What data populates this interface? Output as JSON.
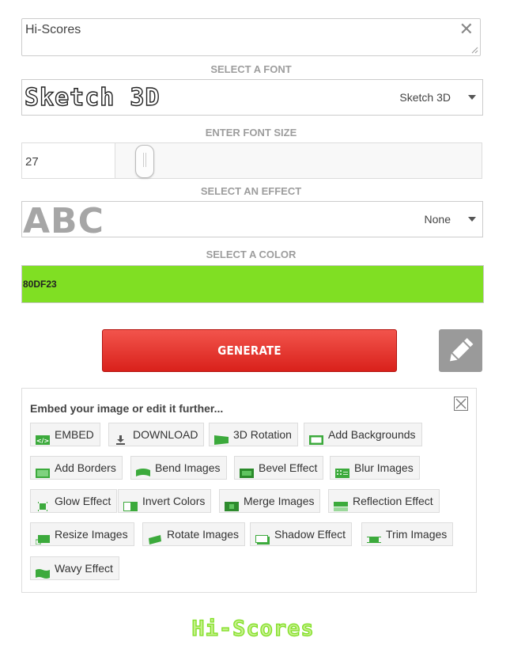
{
  "text_input": {
    "value": "Hi-Scores",
    "clear_icon": "close-icon"
  },
  "font": {
    "label": "SELECT A FONT",
    "preview": "Sketch 3D",
    "selected": "Sketch 3D"
  },
  "size": {
    "label": "ENTER FONT SIZE",
    "value": "27",
    "slider_level_fraction": 0.06
  },
  "effect": {
    "label": "SELECT AN EFFECT",
    "preview": "ABC",
    "selected": "None"
  },
  "color": {
    "label": "SELECT A COLOR",
    "hex": "80DF23",
    "swatch": "#80DF23"
  },
  "actions": {
    "generate": "GENERATE",
    "edit_icon": "pencil-icon"
  },
  "embed": {
    "heading": "Embed your image or edit it further...",
    "close_icon": "close-box-icon",
    "accent": "#3caa3c",
    "tools": [
      {
        "label": "EMBED",
        "icon": "embed-code-icon"
      },
      {
        "label": "DOWNLOAD",
        "icon": "download-icon"
      },
      {
        "label": "3D Rotation",
        "icon": "rotation-3d-icon"
      },
      {
        "label": "Add Backgrounds",
        "icon": "background-icon"
      },
      {
        "label": "Add Borders",
        "icon": "border-icon"
      },
      {
        "label": "Bend Images",
        "icon": "bend-icon"
      },
      {
        "label": "Bevel Effect",
        "icon": "bevel-icon"
      },
      {
        "label": "Blur Images",
        "icon": "blur-icon"
      },
      {
        "label": "Glow Effect",
        "icon": "glow-icon"
      },
      {
        "label": "Invert Colors",
        "icon": "invert-icon"
      },
      {
        "label": "Merge Images",
        "icon": "merge-icon"
      },
      {
        "label": "Reflection Effect",
        "icon": "reflection-icon"
      },
      {
        "label": "Resize Images",
        "icon": "resize-icon"
      },
      {
        "label": "Rotate Images",
        "icon": "rotate-icon"
      },
      {
        "label": "Shadow Effect",
        "icon": "shadow-icon"
      },
      {
        "label": "Trim Images",
        "icon": "trim-icon"
      },
      {
        "label": "Wavy Effect",
        "icon": "wavy-icon"
      }
    ]
  },
  "result": {
    "text": "Hi-Scores"
  }
}
